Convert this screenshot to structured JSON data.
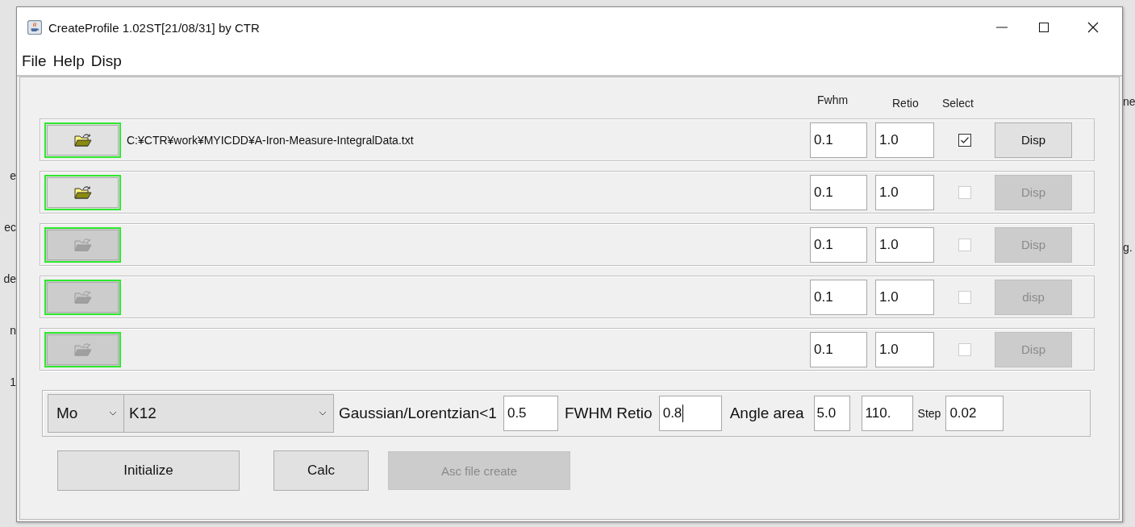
{
  "background": {
    "left_texts": [
      "e",
      "ec",
      "de",
      "n",
      "1"
    ],
    "right_texts": [
      "ne",
      "g."
    ]
  },
  "window": {
    "title": "CreateProfile 1.02ST[21/08/31] by CTR"
  },
  "menu": [
    "File",
    "Help",
    "Disp"
  ],
  "headers": [
    "Fwhm",
    "Retio",
    "Select"
  ],
  "rows": [
    {
      "path": "C:¥CTR¥work¥MYICDD¥A-Iron-Measure-IntegralData.txt",
      "open_enabled": true,
      "fwhm": "0.1",
      "retio": "1.0",
      "checked": true,
      "select_enabled": true,
      "disp_label": "Disp",
      "disp_enabled": true
    },
    {
      "open_enabled": true,
      "fwhm": "0.1",
      "retio": "1.0",
      "checked": false,
      "select_enabled": false,
      "disp_label": "Disp",
      "disp_enabled": false
    },
    {
      "open_enabled": false,
      "fwhm": "0.1",
      "retio": "1.0",
      "checked": false,
      "select_enabled": false,
      "disp_label": "Disp",
      "disp_enabled": false
    },
    {
      "open_enabled": false,
      "fwhm": "0.1",
      "retio": "1.0",
      "checked": false,
      "select_enabled": false,
      "disp_label": "disp",
      "disp_enabled": false
    },
    {
      "open_enabled": false,
      "fwhm": "0.1",
      "retio": "1.0",
      "checked": false,
      "select_enabled": false,
      "disp_label": "Disp",
      "disp_enabled": false
    }
  ],
  "settings": {
    "target": "Mo",
    "line": "K12",
    "ratio_label": "Gaussian/Lorentzian<1",
    "ratio": "0.5",
    "fwhm_label": "FWHM Retio",
    "fwhm_retio": "0.8",
    "fwhm_focused": true,
    "angle_label": "Angle area",
    "angle_from": "5.0",
    "angle_to": "110.",
    "step_label": "Step",
    "step": "0.02"
  },
  "buttons": [
    {
      "label": "Initialize",
      "disabled": false
    },
    {
      "label": "Calc",
      "disabled": false
    },
    {
      "label": "Asc file create",
      "disabled": true
    }
  ]
}
